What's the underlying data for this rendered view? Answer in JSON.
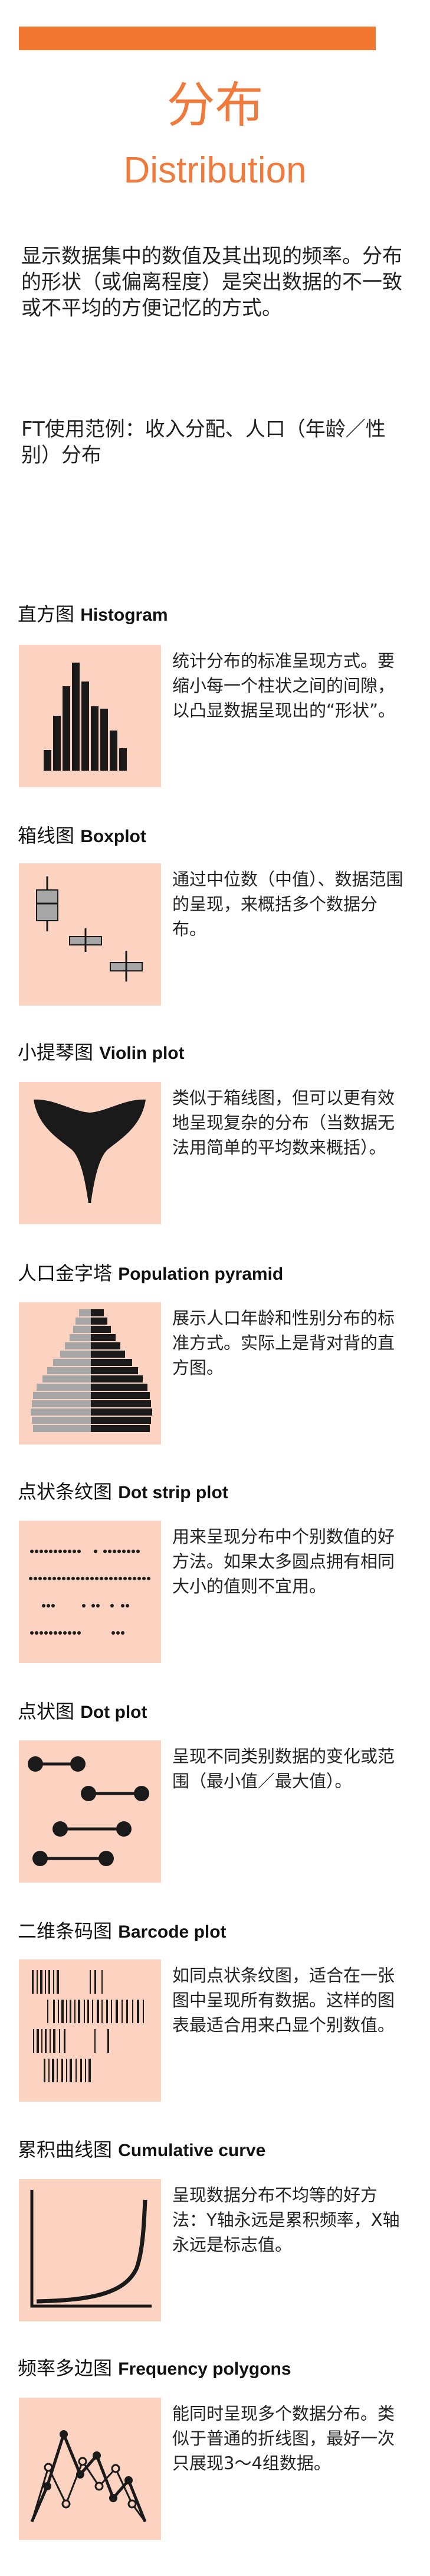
{
  "header": {
    "title_zh": "分布",
    "title_en": "Distribution",
    "intro": "显示数据集中的数值及其出现的频率。分布的形状（或偏离程度）是突出数据的不一致或不平均的方便记忆的方式。",
    "usage": "FT使用范例：收入分配、人口（年龄／性别）分布"
  },
  "colors": {
    "accent": "#f2782f",
    "card_bg": "#fcd3c0",
    "ink": "#1a1a1a"
  },
  "sections": [
    {
      "title_zh": "直方图",
      "title_en": "Histogram",
      "icon": "histogram-icon",
      "desc": "统计分布的标准呈现方式。要缩小每一个柱状之间的间隙，以凸显数据呈现出的“形状”。"
    },
    {
      "title_zh": "箱线图",
      "title_en": "Boxplot",
      "icon": "boxplot-icon",
      "desc": "通过中位数（中值）、数据范围的呈现，来概括多个数据分布。"
    },
    {
      "title_zh": "小提琴图",
      "title_en": "Violin plot",
      "icon": "violin-plot-icon",
      "desc": "类似于箱线图，但可以更有效地呈现复杂的分布（当数据无法用简单的平均数来概括）。"
    },
    {
      "title_zh": "人口金字塔",
      "title_en": "Population pyramid",
      "icon": "population-pyramid-icon",
      "desc": "展示人口年龄和性别分布的标准方式。实际上是背对背的直方图。"
    },
    {
      "title_zh": "点状条纹图",
      "title_en": "Dot strip plot",
      "icon": "dot-strip-plot-icon",
      "desc": "用来呈现分布中个别数值的好方法。如果太多圆点拥有相同大小的值则不宜用。"
    },
    {
      "title_zh": "点状图",
      "title_en": "Dot plot",
      "icon": "dot-plot-icon",
      "desc": "呈现不同类别数据的变化或范围（最小值／最大值）。"
    },
    {
      "title_zh": "二维条码图",
      "title_en": "Barcode plot",
      "icon": "barcode-plot-icon",
      "desc": "如同点状条纹图，适合在一张图中呈现所有数据。这样的图表最适合用来凸显个别数值。"
    },
    {
      "title_zh": "累积曲线图",
      "title_en": "Cumulative curve",
      "icon": "cumulative-curve-icon",
      "desc": "呈现数据分布不均等的好方法：Y轴永远是累积频率，X轴永远是标志值。"
    },
    {
      "title_zh": "频率多边图",
      "title_en": "Frequency polygons",
      "icon": "frequency-polygons-icon",
      "desc": "能同时呈现多个数据分布。类似于普通的折线图，最好一次只展现3～4组数据。"
    }
  ]
}
